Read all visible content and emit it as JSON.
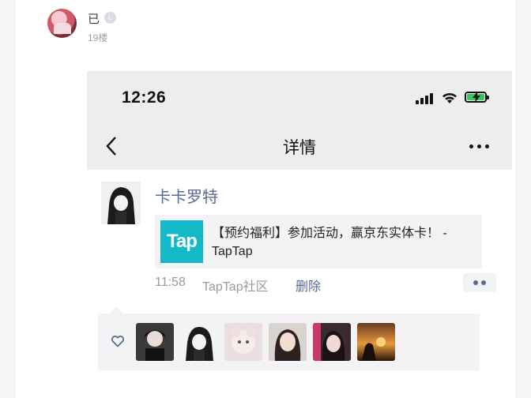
{
  "post": {
    "username": "已",
    "level_badge": "L",
    "floor": "19楼"
  },
  "screenshot": {
    "status_bar": {
      "time": "12:26"
    },
    "nav": {
      "title": "详情"
    },
    "moment": {
      "author": "卡卡罗特",
      "link": {
        "logo_text": "Tap",
        "text": "【预约福利】参加活动，赢京东实体卡！ - TapTap"
      },
      "time": "11:58",
      "source": "TapTap社区",
      "delete_label": "删除"
    },
    "likes": {
      "avatars": [
        "like-avatar-1",
        "like-avatar-2",
        "like-avatar-3",
        "like-avatar-4",
        "like-avatar-5",
        "like-avatar-6"
      ]
    }
  },
  "colors": {
    "link_blue": "#576b95",
    "tap_teal": "#14b9c8",
    "battery_green": "#34c759"
  }
}
